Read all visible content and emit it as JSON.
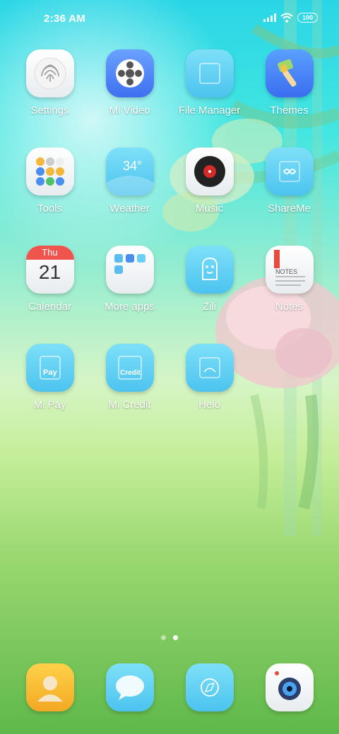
{
  "status": {
    "time": "2:36 AM",
    "battery": "100"
  },
  "apps": [
    [
      {
        "label": "Settings",
        "icon": "fingerprint-icon"
      },
      {
        "label": "Mi Video",
        "icon": "film-reel-icon"
      },
      {
        "label": "File Manager",
        "icon": "folder-icon"
      },
      {
        "label": "Themes",
        "icon": "paintbrush-icon"
      }
    ],
    [
      {
        "label": "Tools",
        "icon": "tools-folder-icon"
      },
      {
        "label": "Weather",
        "icon": "weather-icon",
        "value": "34°"
      },
      {
        "label": "Music",
        "icon": "vinyl-record-icon"
      },
      {
        "label": "ShareMe",
        "icon": "infinity-icon"
      }
    ],
    [
      {
        "label": "Calendar",
        "icon": "calendar-icon",
        "day": "Thu",
        "date": "21"
      },
      {
        "label": "More apps",
        "icon": "apps-folder-icon"
      },
      {
        "label": "Zili",
        "icon": "zili-icon"
      },
      {
        "label": "Notes",
        "icon": "notes-icon",
        "text": "NOTES"
      }
    ],
    [
      {
        "label": "Mi Pay",
        "icon": "mi-pay-icon",
        "text": "Pay"
      },
      {
        "label": "Mi Credit",
        "icon": "mi-credit-icon",
        "text": "Credit"
      },
      {
        "label": "Helo",
        "icon": "helo-icon"
      }
    ]
  ],
  "pager": {
    "pages": 2,
    "current": 2
  },
  "dock": [
    {
      "icon": "contacts-icon"
    },
    {
      "icon": "messages-icon"
    },
    {
      "icon": "browser-icon"
    },
    {
      "icon": "camera-icon"
    }
  ],
  "colors": {
    "accent_blue": "#4cc3ef",
    "calendar_red": "#f0554d"
  }
}
